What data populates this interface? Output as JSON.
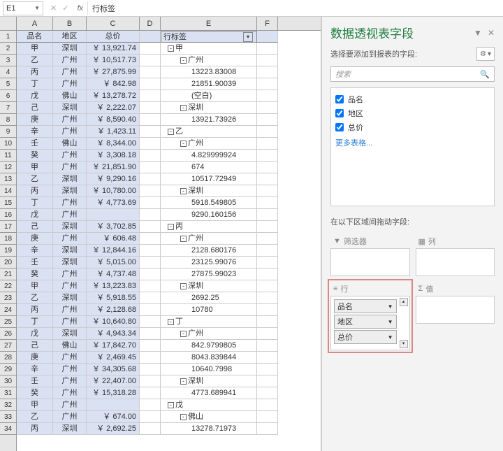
{
  "formula_bar": {
    "cell_ref": "E1",
    "fx": "fx",
    "value": "行标签"
  },
  "columns": [
    "A",
    "B",
    "C",
    "D",
    "E",
    "F"
  ],
  "headers": {
    "A": "品名",
    "B": "地区",
    "C": "总价"
  },
  "rows": [
    {
      "n": 1,
      "A": "品名",
      "B": "地区",
      "C": "总价",
      "E": "行标签",
      "hdr": true,
      "ehdr": true
    },
    {
      "n": 2,
      "A": "甲",
      "B": "深圳",
      "C": "￥ 13,921.74",
      "E": "甲",
      "lvl": 1,
      "tog": "-"
    },
    {
      "n": 3,
      "A": "乙",
      "B": "广州",
      "C": "￥ 10,517.73",
      "E": "广州",
      "lvl": 2,
      "tog": "-"
    },
    {
      "n": 4,
      "A": "丙",
      "B": "广州",
      "C": "￥ 27,875.99",
      "E": "13223.83008",
      "lvl": 3
    },
    {
      "n": 5,
      "A": "丁",
      "B": "广州",
      "C": "￥    842.98",
      "E": "21851.90039",
      "lvl": 3
    },
    {
      "n": 6,
      "A": "戊",
      "B": "佛山",
      "C": "￥ 13,278.72",
      "E": "(空白)",
      "lvl": 3
    },
    {
      "n": 7,
      "A": "己",
      "B": "深圳",
      "C": "￥  2,222.07",
      "E": "深圳",
      "lvl": 2,
      "tog": "-"
    },
    {
      "n": 8,
      "A": "庚",
      "B": "广州",
      "C": "￥  8,590.40",
      "E": "13921.73926",
      "lvl": 3
    },
    {
      "n": 9,
      "A": "辛",
      "B": "广州",
      "C": "￥  1,423.11",
      "E": "乙",
      "lvl": 1,
      "tog": "-"
    },
    {
      "n": 10,
      "A": "壬",
      "B": "佛山",
      "C": "￥  8,344.00",
      "E": "广州",
      "lvl": 2,
      "tog": "-"
    },
    {
      "n": 11,
      "A": "癸",
      "B": "广州",
      "C": "￥  3,308.18",
      "E": "4.829999924",
      "lvl": 3
    },
    {
      "n": 12,
      "A": "甲",
      "B": "广州",
      "C": "￥ 21,851.90",
      "E": "674",
      "lvl": 3
    },
    {
      "n": 13,
      "A": "乙",
      "B": "深圳",
      "C": "￥  9,290.16",
      "E": "10517.72949",
      "lvl": 3
    },
    {
      "n": 14,
      "A": "丙",
      "B": "深圳",
      "C": "￥ 10,780.00",
      "E": "深圳",
      "lvl": 2,
      "tog": "-"
    },
    {
      "n": 15,
      "A": "丁",
      "B": "广州",
      "C": "￥  4,773.69",
      "E": "5918.549805",
      "lvl": 3
    },
    {
      "n": 16,
      "A": "戊",
      "B": "广州",
      "C": "",
      "E": "9290.160156",
      "lvl": 3
    },
    {
      "n": 17,
      "A": "己",
      "B": "深圳",
      "C": "￥  3,702.85",
      "E": "丙",
      "lvl": 1,
      "tog": "-"
    },
    {
      "n": 18,
      "A": "庚",
      "B": "广州",
      "C": "￥    606.48",
      "E": "广州",
      "lvl": 2,
      "tog": "-"
    },
    {
      "n": 19,
      "A": "辛",
      "B": "深圳",
      "C": "￥ 12,844.16",
      "E": "2128.680176",
      "lvl": 3
    },
    {
      "n": 20,
      "A": "壬",
      "B": "深圳",
      "C": "￥  5,015.00",
      "E": "23125.99076",
      "lvl": 3
    },
    {
      "n": 21,
      "A": "癸",
      "B": "广州",
      "C": "￥  4,737.48",
      "E": "27875.99023",
      "lvl": 3
    },
    {
      "n": 22,
      "A": "甲",
      "B": "广州",
      "C": "￥ 13,223.83",
      "E": "深圳",
      "lvl": 2,
      "tog": "-"
    },
    {
      "n": 23,
      "A": "乙",
      "B": "深圳",
      "C": "￥  5,918.55",
      "E": "2692.25",
      "lvl": 3
    },
    {
      "n": 24,
      "A": "丙",
      "B": "广州",
      "C": "￥  2,128.68",
      "E": "10780",
      "lvl": 3
    },
    {
      "n": 25,
      "A": "丁",
      "B": "广州",
      "C": "￥ 10,640.80",
      "E": "丁",
      "lvl": 1,
      "tog": "-"
    },
    {
      "n": 26,
      "A": "戊",
      "B": "深圳",
      "C": "￥  4,943.34",
      "E": "广州",
      "lvl": 2,
      "tog": "-"
    },
    {
      "n": 27,
      "A": "己",
      "B": "佛山",
      "C": "￥ 17,842.70",
      "E": "842.9799805",
      "lvl": 3
    },
    {
      "n": 28,
      "A": "庚",
      "B": "广州",
      "C": "￥  2,469.45",
      "E": "8043.839844",
      "lvl": 3
    },
    {
      "n": 29,
      "A": "辛",
      "B": "广州",
      "C": "￥ 34,305.68",
      "E": "10640.7998",
      "lvl": 3
    },
    {
      "n": 30,
      "A": "壬",
      "B": "广州",
      "C": "￥ 22,407.00",
      "E": "深圳",
      "lvl": 2,
      "tog": "-"
    },
    {
      "n": 31,
      "A": "癸",
      "B": "广州",
      "C": "￥ 15,318.28",
      "E": "4773.689941",
      "lvl": 3
    },
    {
      "n": 32,
      "A": "甲",
      "B": "广州",
      "C": "",
      "E": "戊",
      "lvl": 1,
      "tog": "-"
    },
    {
      "n": 33,
      "A": "乙",
      "B": "广州",
      "C": "￥    674.00",
      "E": "佛山",
      "lvl": 2,
      "tog": "-"
    },
    {
      "n": 34,
      "A": "丙",
      "B": "深圳",
      "C": "￥  2,692.25",
      "E": "13278.71973",
      "lvl": 3
    }
  ],
  "pane": {
    "title": "数据透视表字段",
    "subtitle": "选择要添加到报表的字段:",
    "search_placeholder": "搜索",
    "fields": [
      {
        "label": "品名",
        "checked": true
      },
      {
        "label": "地区",
        "checked": true
      },
      {
        "label": "总价",
        "checked": true
      }
    ],
    "more_tables": "更多表格...",
    "drop_label": "在以下区域间拖动字段:",
    "zones": {
      "filter": {
        "title": "筛选器",
        "icon": "▼"
      },
      "columns": {
        "title": "列",
        "icon": "|||"
      },
      "rows": {
        "title": "行",
        "icon": "≡",
        "items": [
          "品名",
          "地区",
          "总价"
        ]
      },
      "values": {
        "title": "值",
        "icon": "Σ"
      }
    }
  }
}
